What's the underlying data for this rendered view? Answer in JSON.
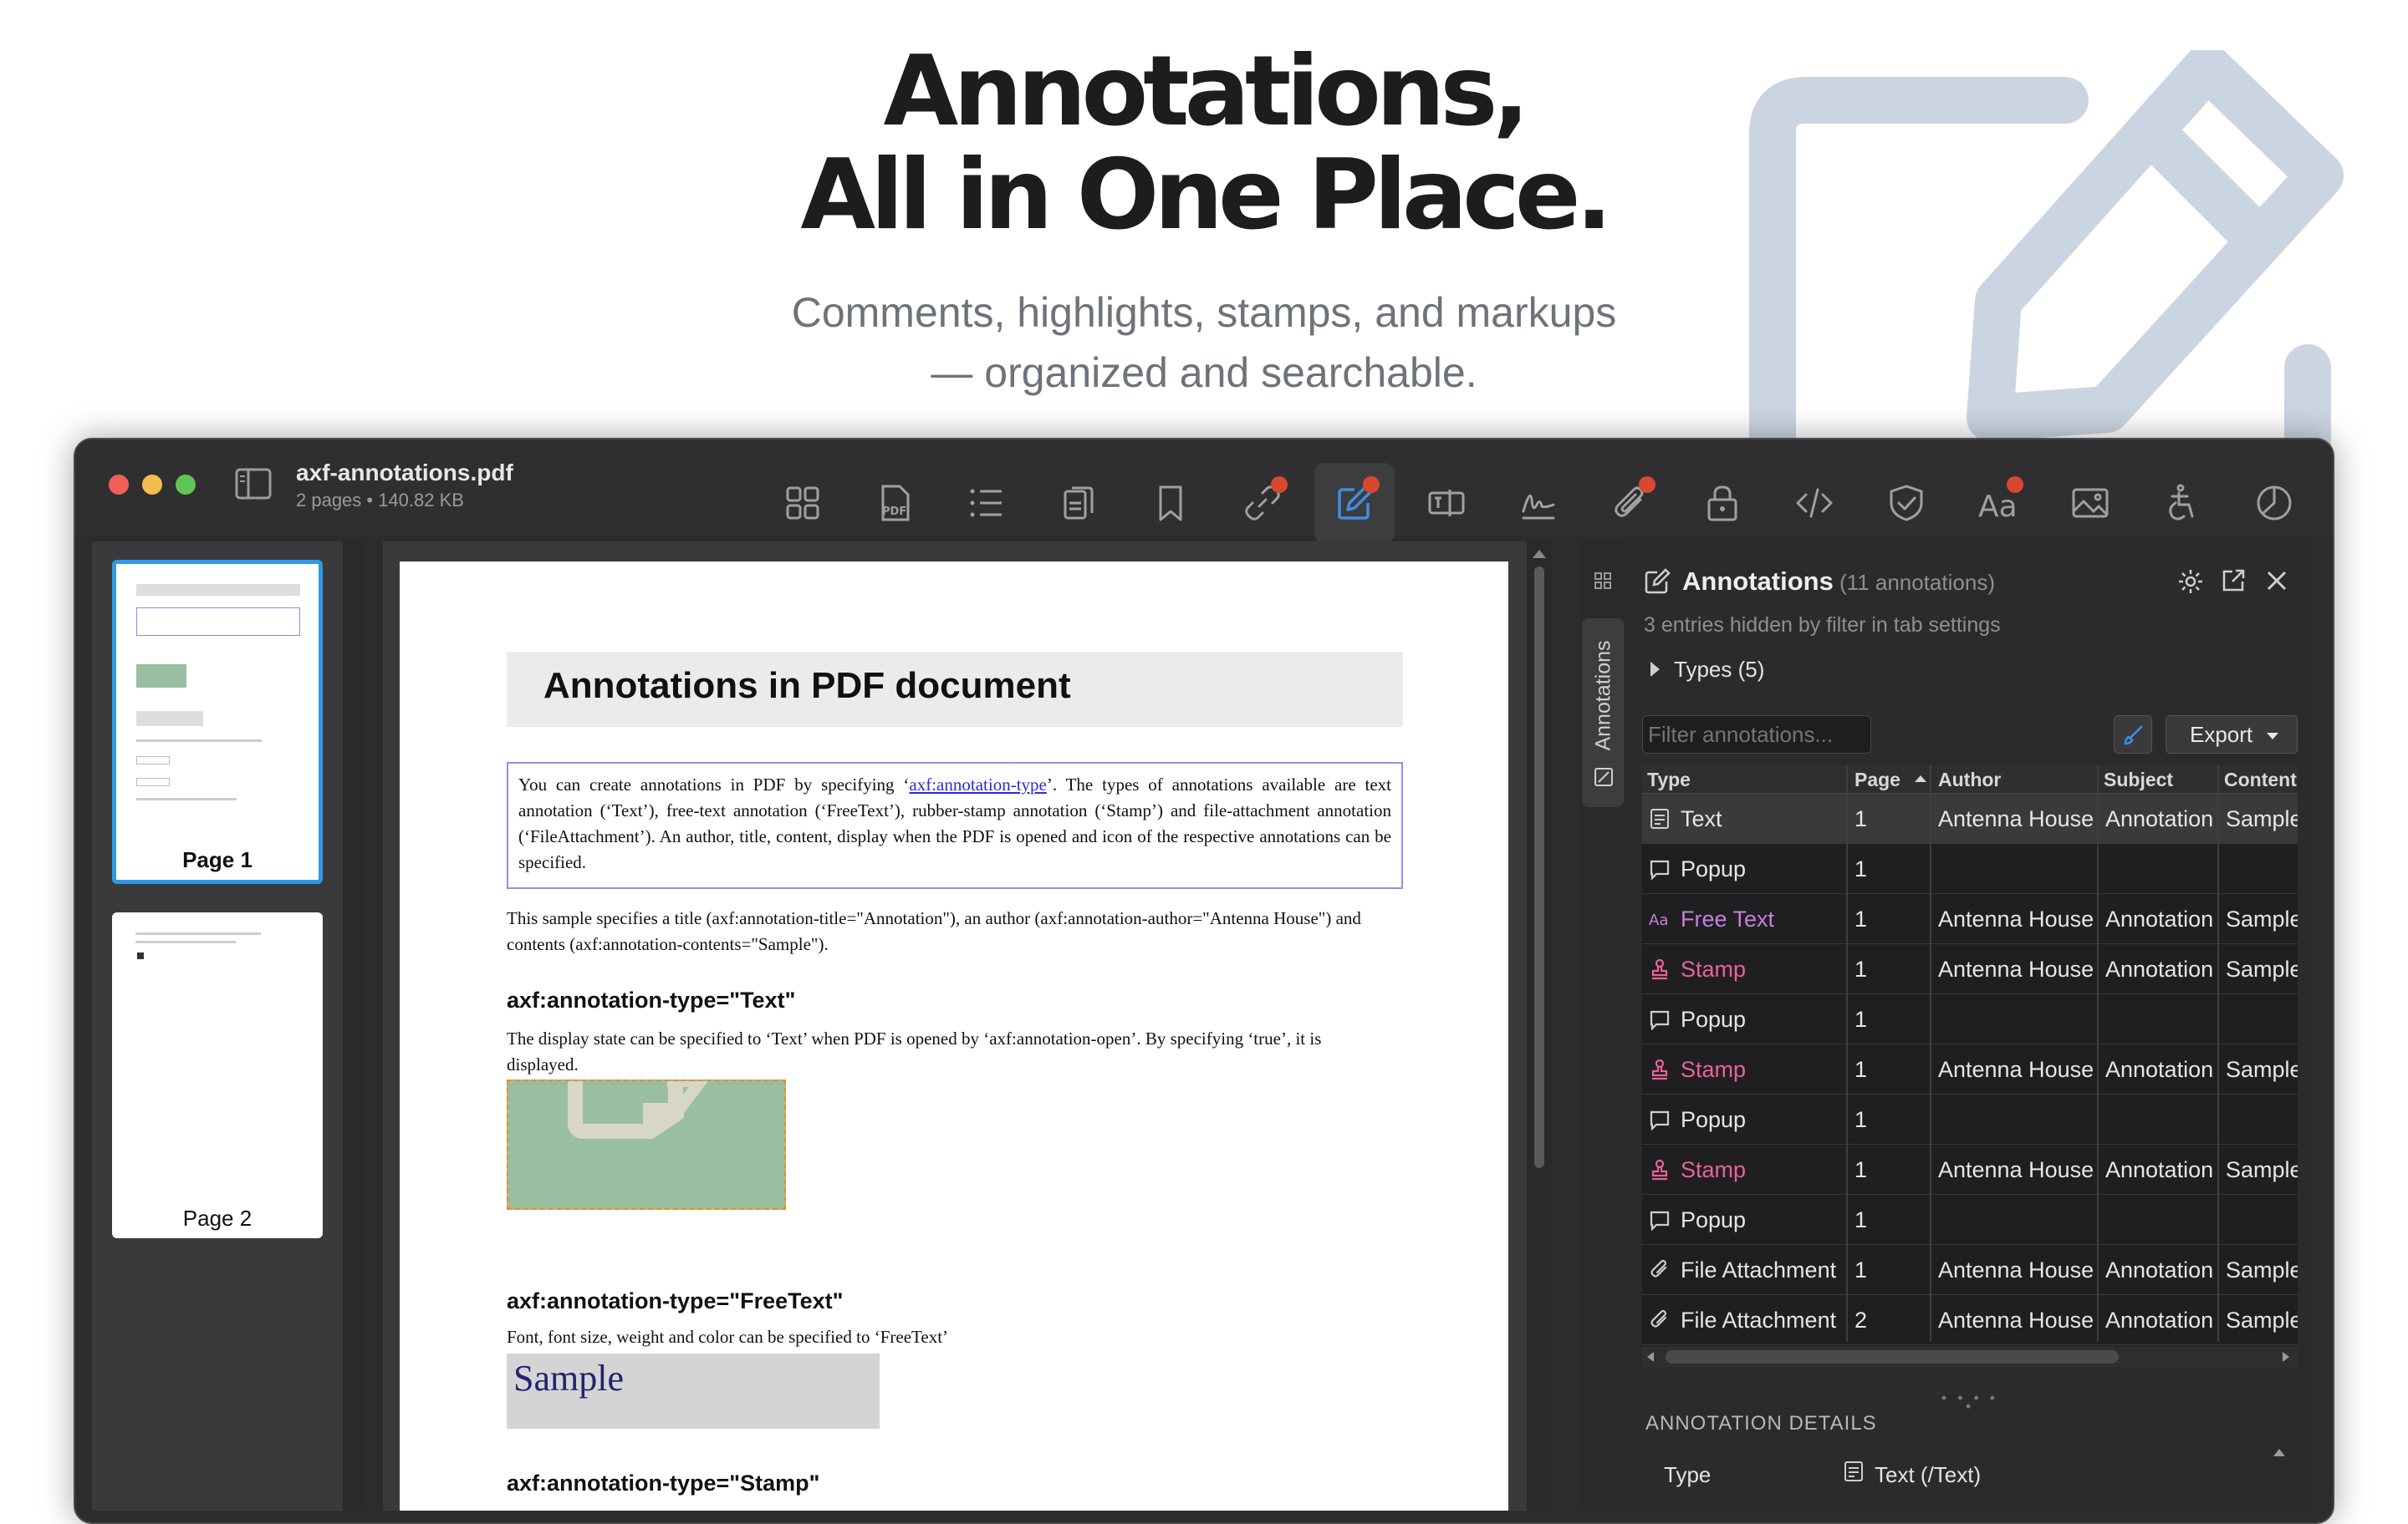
{
  "hero": {
    "title_line1": "Annotations,",
    "title_line2": "All in One Place.",
    "subtitle_line1": "Comments, highlights, stamps, and markups",
    "subtitle_line2": "— organized and searchable."
  },
  "window": {
    "file_name": "axf-annotations.pdf",
    "file_meta": "2 pages • 140.82 KB",
    "toolbar": [
      "grid-icon",
      "pdf-icon",
      "list-icon",
      "pages-icon",
      "bookmark-icon",
      "link-icon",
      "annotation-edit-icon",
      "text-field-icon",
      "signature-icon",
      "attachment-icon",
      "lock-icon",
      "code-icon",
      "shield-check-icon",
      "font-icon",
      "image-icon",
      "accessibility-icon",
      "pie-chart-icon"
    ]
  },
  "thumbnails": {
    "page1_label": "Page 1",
    "page2_label": "Page 2"
  },
  "document": {
    "heading": "Annotations in PDF document",
    "intro_pre": "You can create annotations in PDF by specifying ‘",
    "intro_link": "axf:annotation-type",
    "intro_post": "’. The types of annotations available are text annotation (‘Text’), free-text annotation (‘FreeText’), rubber-stamp annotation (‘Stamp’) and file-attachment annotation (‘FileAttachment’). An author, title, content, display when the PDF is opened and icon of the respective annotations can be specified.",
    "sample_note": "This sample specifies a title (axf:annotation-title=\"Annotation\"), an author (axf:annotation-author=\"Antenna House\") and contents (axf:annotation-contents=\"Sample\").",
    "h_text": "axf:annotation-type=\"Text\"",
    "p_text": "The display state can be specified to ‘Text’ when PDF is opened by ‘axf:annotation-open’. By specifying ‘true’, it is displayed.",
    "h_freetext": "axf:annotation-type=\"FreeText\"",
    "p_freetext": "Font, font size, weight and color can be specified to ‘FreeText’",
    "freetext_sample": "Sample",
    "h_stamp": "axf:annotation-type=\"Stamp\""
  },
  "panel": {
    "tab_label": "Annotations",
    "title": "Annotations",
    "count": "(11 annotations)",
    "hidden_note": "3 entries hidden by filter in tab settings",
    "types_label": "Types (5)",
    "filter_placeholder": "Filter annotations...",
    "export_label": "Export",
    "columns": [
      "Type",
      "Page",
      "Author",
      "Subject",
      "Content"
    ],
    "rows": [
      {
        "icon": "note-icon",
        "type": "Text",
        "page": "1",
        "author": "Antenna House",
        "subject": "Annotation",
        "content": "Sample",
        "color": "#e6e6e8"
      },
      {
        "icon": "popup-icon",
        "type": "Popup",
        "page": "1",
        "author": "",
        "subject": "",
        "content": "",
        "color": "#e6e6e8"
      },
      {
        "icon": "freetext-icon",
        "type": "Free Text",
        "page": "1",
        "author": "Antenna House",
        "subject": "Annotation",
        "content": "Sample",
        "color": "#c67fe0"
      },
      {
        "icon": "stamp-icon",
        "type": "Stamp",
        "page": "1",
        "author": "Antenna House",
        "subject": "Annotation",
        "content": "Sample",
        "color": "#e8629a"
      },
      {
        "icon": "popup-icon",
        "type": "Popup",
        "page": "1",
        "author": "",
        "subject": "",
        "content": "",
        "color": "#e6e6e8"
      },
      {
        "icon": "stamp-icon",
        "type": "Stamp",
        "page": "1",
        "author": "Antenna House",
        "subject": "Annotation",
        "content": "Sample",
        "color": "#e8629a"
      },
      {
        "icon": "popup-icon",
        "type": "Popup",
        "page": "1",
        "author": "",
        "subject": "",
        "content": "",
        "color": "#e6e6e8"
      },
      {
        "icon": "stamp-icon",
        "type": "Stamp",
        "page": "1",
        "author": "Antenna House",
        "subject": "Annotation",
        "content": "Sample",
        "color": "#e8629a"
      },
      {
        "icon": "popup-icon",
        "type": "Popup",
        "page": "1",
        "author": "",
        "subject": "",
        "content": "",
        "color": "#e6e6e8"
      },
      {
        "icon": "paperclip-icon",
        "type": "File Attachment",
        "page": "1",
        "author": "Antenna House",
        "subject": "Annotation",
        "content": "Sample",
        "color": "#e6e6e8"
      },
      {
        "icon": "paperclip-icon",
        "type": "File Attachment",
        "page": "2",
        "author": "Antenna House",
        "subject": "Annotation",
        "content": "Sample",
        "color": "#e6e6e8"
      }
    ],
    "details_header": "ANNOTATION DETAILS",
    "detail_type_label": "Type",
    "detail_type_value": "Text (/Text)"
  },
  "colors": {
    "accent": "#3d8fe0",
    "deco": "#cbd5e1",
    "badge": "#d9472f"
  }
}
